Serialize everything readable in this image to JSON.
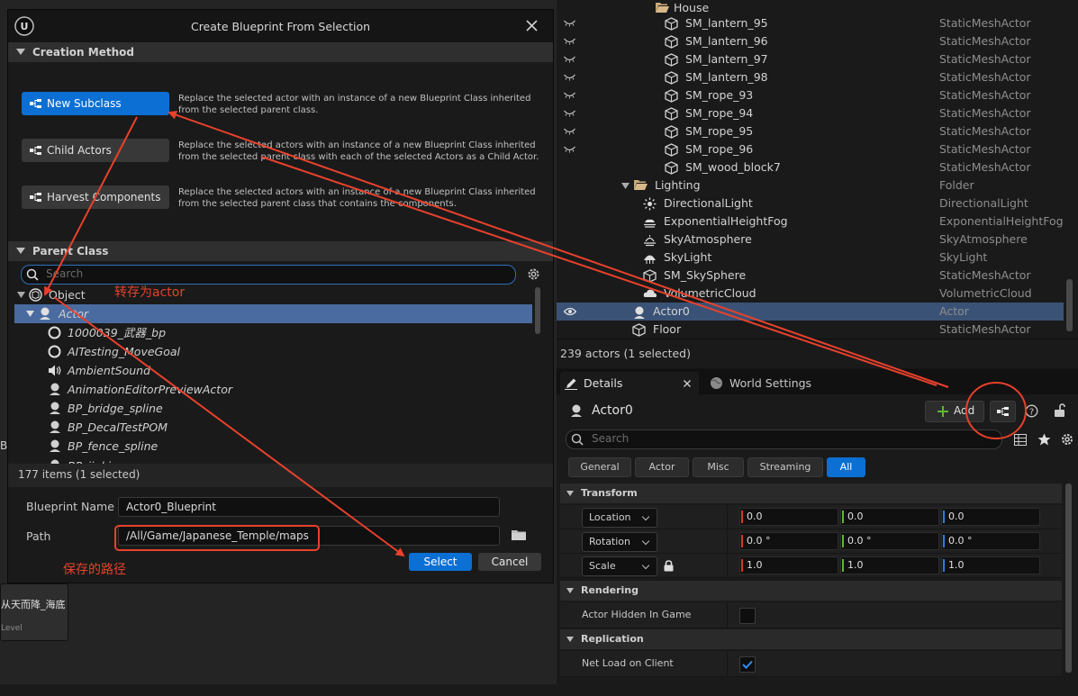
{
  "dialog": {
    "title": "Create Blueprint From Selection",
    "creation_method_header": "Creation Method",
    "methods": [
      {
        "label": "New Subclass",
        "desc1": "Replace the selected actor with an instance of a new Blueprint Class inherited",
        "desc2": "from the selected parent class."
      },
      {
        "label": "Child Actors",
        "desc1": "Replace the selected actors with an instance of a new Blueprint Class inherited",
        "desc2": "from the selected parent class with each of the selected Actors as a Child Actor."
      },
      {
        "label": "Harvest Components",
        "desc1": "Replace the selected actors with an instance of a new Blueprint Class inherited",
        "desc2": "from the selected parent class that contains the components."
      }
    ],
    "parent_class_header": "Parent Class",
    "search_placeholder": "Search",
    "tree": [
      "Object",
      "Actor",
      "1000039_武器_bp",
      "AITesting_MoveGoal",
      "AmbientSound",
      "AnimationEditorPreviewActor",
      "BP_bridge_spline",
      "BP_DecalTestPOM",
      "BP_fence_spline",
      "BP_jinki"
    ],
    "items_count": "177 items (1 selected)",
    "blueprint_name_label": "Blueprint Name",
    "blueprint_name_value": "Actor0_Blueprint",
    "path_label": "Path",
    "path_value": "/All/Game/Japanese_Temple/maps",
    "select_label": "Select",
    "cancel_label": "Cancel"
  },
  "annotations": {
    "to_actor": "转存为actor",
    "save_path": "保存的路径"
  },
  "background": {
    "tile_text": "从天而降_海底",
    "tile_sub": "Level",
    "edge_char": "B"
  },
  "outliner": {
    "folder_house": "House",
    "rows": [
      {
        "name": "SM_lantern_95",
        "type": "StaticMeshActor"
      },
      {
        "name": "SM_lantern_96",
        "type": "StaticMeshActor"
      },
      {
        "name": "SM_lantern_97",
        "type": "StaticMeshActor"
      },
      {
        "name": "SM_lantern_98",
        "type": "StaticMeshActor"
      },
      {
        "name": "SM_rope_93",
        "type": "StaticMeshActor"
      },
      {
        "name": "SM_rope_94",
        "type": "StaticMeshActor"
      },
      {
        "name": "SM_rope_95",
        "type": "StaticMeshActor"
      },
      {
        "name": "SM_rope_96",
        "type": "StaticMeshActor"
      },
      {
        "name": "SM_wood_block7",
        "type": "StaticMeshActor"
      },
      {
        "name": "Lighting",
        "type": "Folder"
      },
      {
        "name": "DirectionalLight",
        "type": "DirectionalLight"
      },
      {
        "name": "ExponentialHeightFog",
        "type": "ExponentialHeightFog"
      },
      {
        "name": "SkyAtmosphere",
        "type": "SkyAtmosphere"
      },
      {
        "name": "SkyLight",
        "type": "SkyLight"
      },
      {
        "name": "SM_SkySphere",
        "type": "StaticMeshActor"
      },
      {
        "name": "VolumetricCloud",
        "type": "VolumetricCloud"
      },
      {
        "name": "Actor0",
        "type": "Actor"
      },
      {
        "name": "Floor",
        "type": "StaticMeshActor"
      }
    ],
    "status": "239 actors (1 selected)"
  },
  "details": {
    "tab_details": "Details",
    "tab_world": "World Settings",
    "actor_name": "Actor0",
    "add_label": "Add",
    "search_placeholder": "Search",
    "filter_tabs": [
      "General",
      "Actor",
      "Misc",
      "Streaming",
      "All"
    ],
    "transform_header": "Transform",
    "location_label": "Location",
    "rotation_label": "Rotation",
    "scale_label": "Scale",
    "location": [
      "0.0",
      "0.0",
      "0.0"
    ],
    "rotation": [
      "0.0 °",
      "0.0 °",
      "0.0 °"
    ],
    "scale": [
      "1.0",
      "1.0",
      "1.0"
    ],
    "rendering_header": "Rendering",
    "hidden_label": "Actor Hidden In Game",
    "replication_header": "Replication",
    "netload_label": "Net Load on Client"
  },
  "colors": {
    "accent": "#0b6fd3",
    "annotation_red": "#e8412c",
    "axis_x": "#d9342a",
    "axis_y": "#5db835",
    "axis_z": "#2e7ce8"
  }
}
